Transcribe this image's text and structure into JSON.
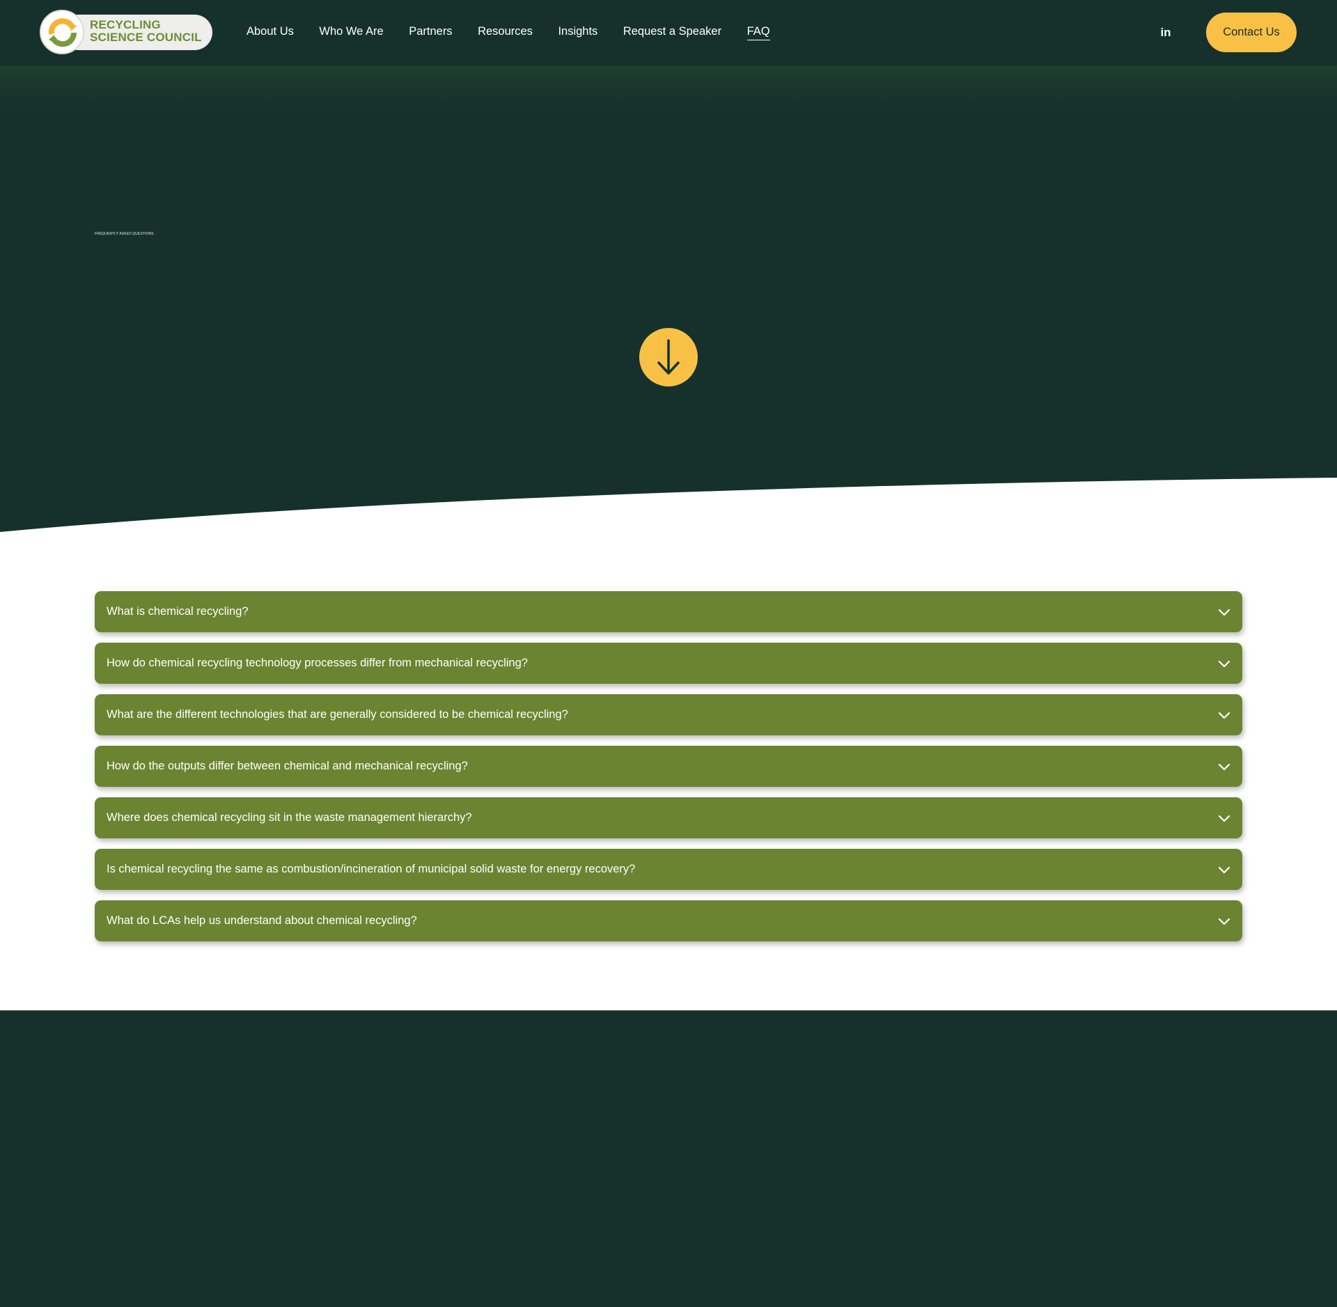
{
  "brand": {
    "line1": "RECYCLING",
    "line2": "SCIENCE COUNCIL",
    "logo_icon": "recycle-circle-icon"
  },
  "nav": {
    "items": [
      {
        "label": "About Us"
      },
      {
        "label": "Who We Are"
      },
      {
        "label": "Partners"
      },
      {
        "label": "Resources"
      },
      {
        "label": "Insights"
      },
      {
        "label": "Request a Speaker"
      },
      {
        "label": "FAQ",
        "active": true
      }
    ]
  },
  "header": {
    "linkedin_label": "in",
    "contact_label": "Contact Us"
  },
  "hero": {
    "eyebrow": "FREQUENTLY ASKED QUESTIONS",
    "scroll_icon": "arrow-down-icon"
  },
  "faq": {
    "items": [
      {
        "question": "What is chemical recycling?"
      },
      {
        "question": "How do chemical recycling technology processes differ from mechanical recycling?"
      },
      {
        "question": "What are the different technologies that are generally considered to be chemical recycling?"
      },
      {
        "question": "How do the outputs differ between chemical and mechanical recycling?"
      },
      {
        "question": "Where does chemical recycling sit in the waste management hierarchy?"
      },
      {
        "question": "Is chemical recycling the same as combustion/incineration of municipal solid waste for energy recovery?"
      },
      {
        "question": "What do LCAs help us understand about chemical recycling?"
      }
    ],
    "expand_icon": "chevron-down-icon"
  },
  "colors": {
    "background": "#16312c",
    "accent": "#f8c146",
    "faq_bar": "#6b8431",
    "logo_green": "#6e8c34"
  }
}
